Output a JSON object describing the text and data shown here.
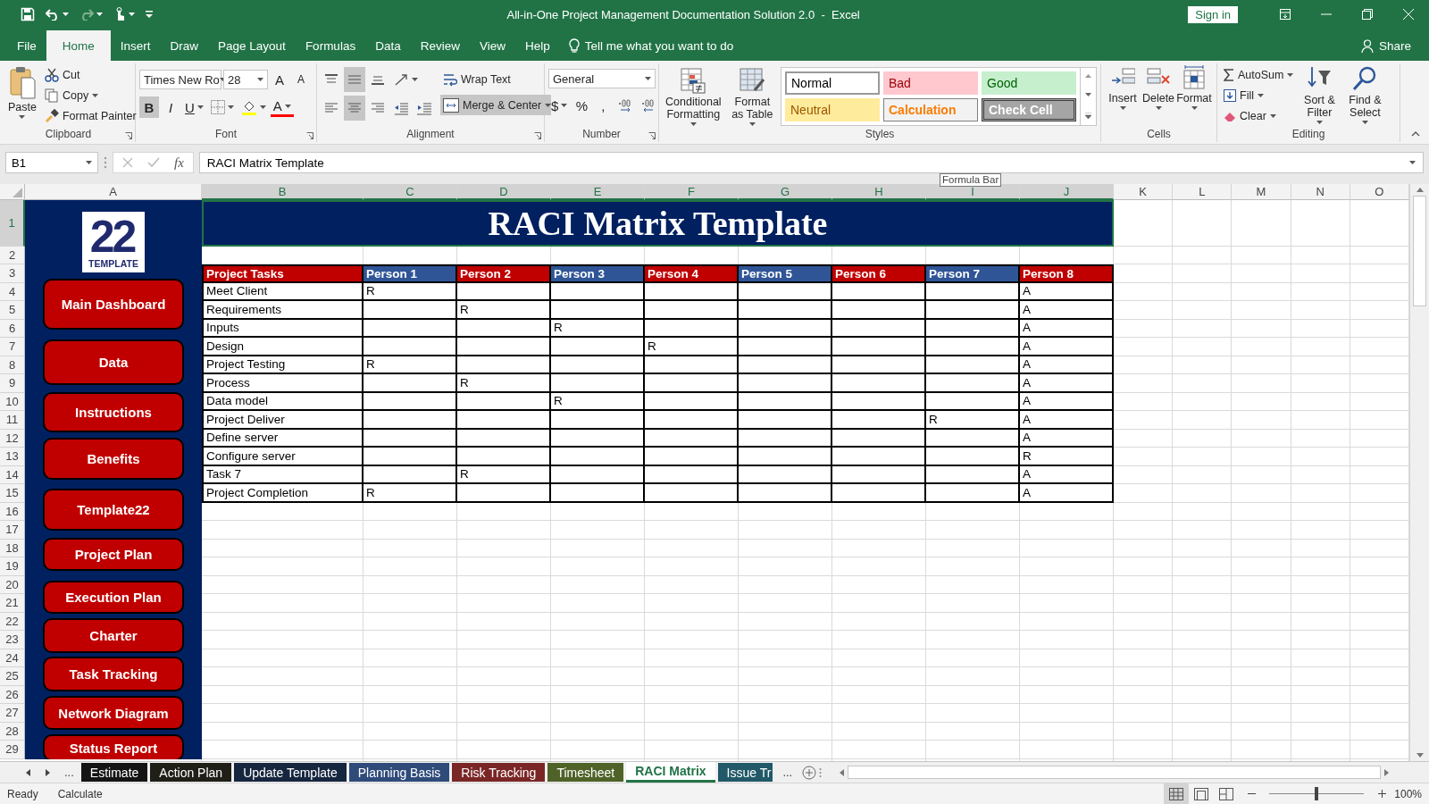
{
  "title_bar": {
    "title": "All-in-One Project Management Documentation Solution 2.0  -  Excel",
    "sign_in": "Sign in"
  },
  "menu_tabs": [
    {
      "label": "File",
      "selected": false
    },
    {
      "label": "Home",
      "selected": true
    },
    {
      "label": "Insert",
      "selected": false
    },
    {
      "label": "Draw",
      "selected": false
    },
    {
      "label": "Page Layout",
      "selected": false
    },
    {
      "label": "Formulas",
      "selected": false
    },
    {
      "label": "Data",
      "selected": false
    },
    {
      "label": "Review",
      "selected": false
    },
    {
      "label": "View",
      "selected": false
    },
    {
      "label": "Help",
      "selected": false
    }
  ],
  "tell_me": "Tell me what you want to do",
  "share": "Share",
  "ribbon": {
    "clipboard": {
      "paste": "Paste",
      "cut": "Cut",
      "copy": "Copy",
      "format_painter": "Format Painter",
      "label": "Clipboard"
    },
    "font": {
      "name": "Times New Ro",
      "size": "28",
      "grow": "A",
      "shrink": "A",
      "styles": [
        {
          "label": "B",
          "pressed": true
        },
        {
          "label": "I",
          "pressed": false
        },
        {
          "label": "U",
          "pressed": false
        }
      ],
      "font_color": "A",
      "label": "Font"
    },
    "alignment": {
      "align_buttons": [
        {
          "pressed": false
        },
        {
          "pressed": true
        },
        {
          "pressed": false
        },
        {
          "pressed": false
        },
        {
          "pressed": true
        },
        {
          "pressed": false
        }
      ],
      "wrap_text": "Wrap Text",
      "merge_center": {
        "label": "Merge & Center",
        "pressed": true
      },
      "label": "Alignment"
    },
    "number": {
      "format": "General",
      "symbols": [
        "$",
        "%",
        ","
      ],
      "label": "Number"
    },
    "styles": {
      "conditional_formatting": "Conditional Formatting",
      "format_as_table": "Format as Table",
      "gallery": [
        {
          "label": "Normal",
          "kind": "normal"
        },
        {
          "label": "Bad",
          "kind": "bad"
        },
        {
          "label": "Good",
          "kind": "good"
        },
        {
          "label": "Neutral",
          "kind": "neutral"
        },
        {
          "label": "Calculation",
          "kind": "calculation"
        },
        {
          "label": "Check Cell",
          "kind": "check"
        }
      ],
      "label": "Styles"
    },
    "cells": {
      "buttons": [
        "Insert",
        "Delete",
        "Format"
      ],
      "label": "Cells"
    },
    "editing": {
      "autosum": "AutoSum",
      "fill": "Fill",
      "clear": "Clear",
      "sort_filter": "Sort & Filter",
      "find_select": "Find & Select",
      "label": "Editing"
    }
  },
  "formula_bar": {
    "name_box": "B1",
    "function_symbol": "fx",
    "formula": "RACI Matrix Template",
    "tooltip": "Formula Bar"
  },
  "sheet": {
    "columns": [
      {
        "label": "A",
        "selected": false
      },
      {
        "label": "B",
        "selected": true
      },
      {
        "label": "C",
        "selected": true
      },
      {
        "label": "D",
        "selected": true
      },
      {
        "label": "E",
        "selected": true
      },
      {
        "label": "F",
        "selected": true
      },
      {
        "label": "G",
        "selected": true
      },
      {
        "label": "H",
        "selected": true
      },
      {
        "label": "I",
        "selected": true
      },
      {
        "label": "J",
        "selected": true
      },
      {
        "label": "K",
        "selected": false
      },
      {
        "label": "L",
        "selected": false
      },
      {
        "label": "M",
        "selected": false
      },
      {
        "label": "N",
        "selected": false
      },
      {
        "label": "O",
        "selected": false
      }
    ],
    "rows": [
      {
        "label": "1",
        "selected": true
      },
      {
        "label": "2",
        "selected": false
      },
      {
        "label": "3",
        "selected": false
      },
      {
        "label": "4",
        "selected": false
      },
      {
        "label": "5",
        "selected": false
      },
      {
        "label": "6",
        "selected": false
      },
      {
        "label": "7",
        "selected": false
      },
      {
        "label": "8",
        "selected": false
      },
      {
        "label": "9",
        "selected": false
      },
      {
        "label": "10",
        "selected": false
      },
      {
        "label": "11",
        "selected": false
      },
      {
        "label": "12",
        "selected": false
      },
      {
        "label": "13",
        "selected": false
      },
      {
        "label": "14",
        "selected": false
      },
      {
        "label": "15",
        "selected": false
      },
      {
        "label": "16",
        "selected": false
      },
      {
        "label": "17",
        "selected": false
      },
      {
        "label": "18",
        "selected": false
      },
      {
        "label": "19",
        "selected": false
      },
      {
        "label": "20",
        "selected": false
      },
      {
        "label": "21",
        "selected": false
      },
      {
        "label": "22",
        "selected": false
      },
      {
        "label": "23",
        "selected": false
      },
      {
        "label": "24",
        "selected": false
      },
      {
        "label": "25",
        "selected": false
      },
      {
        "label": "26",
        "selected": false
      },
      {
        "label": "27",
        "selected": false
      },
      {
        "label": "28",
        "selected": false
      },
      {
        "label": "29",
        "selected": false
      }
    ],
    "logo": {
      "number": "22",
      "word": "TEMPLATE"
    },
    "sidebar_buttons": [
      "Main Dashboard",
      "Data",
      "Instructions",
      "Benefits",
      "Template22",
      "Project Plan",
      "Execution Plan",
      "Charter",
      "Task Tracking",
      "Network Diagram",
      "Status Report"
    ],
    "title": "RACI Matrix Template",
    "table": {
      "headers": [
        {
          "label": "Project Tasks",
          "color": "#c00000"
        },
        {
          "label": "Person 1",
          "color": "#2f5597"
        },
        {
          "label": "Person 2",
          "color": "#c00000"
        },
        {
          "label": "Person 3",
          "color": "#2f5597"
        },
        {
          "label": "Person 4",
          "color": "#c00000"
        },
        {
          "label": "Person 5",
          "color": "#2f5597"
        },
        {
          "label": "Person 6",
          "color": "#c00000"
        },
        {
          "label": "Person 7",
          "color": "#2f5597"
        },
        {
          "label": "Person 8",
          "color": "#c00000"
        }
      ],
      "rows": [
        {
          "task": "Meet Client",
          "entries": {
            "person_1": "R",
            "person_8": "A"
          }
        },
        {
          "task": "Requirements",
          "entries": {
            "person_2": "R",
            "person_8": "A"
          }
        },
        {
          "task": "Inputs",
          "entries": {
            "person_3": "R",
            "person_8": "A"
          }
        },
        {
          "task": "Design",
          "entries": {
            "person_4": "R",
            "person_8": "A"
          }
        },
        {
          "task": "Project Testing",
          "entries": {
            "person_1": "R",
            "person_8": "A"
          }
        },
        {
          "task": "Process",
          "entries": {
            "person_2": "R",
            "person_8": "A"
          }
        },
        {
          "task": "Data model",
          "entries": {
            "person_3": "R",
            "person_8": "A"
          }
        },
        {
          "task": "Project Deliver",
          "entries": {
            "person_7": "R",
            "person_8": "A"
          }
        },
        {
          "task": "Define server",
          "entries": {
            "person_8": "A"
          }
        },
        {
          "task": "Configure server",
          "entries": {
            "person_8": "R"
          }
        },
        {
          "task": "Task 7",
          "entries": {
            "person_2": "R",
            "person_8": "A"
          }
        },
        {
          "task": "Project Completion",
          "entries": {
            "person_1": "R",
            "person_8": "A"
          }
        }
      ]
    }
  },
  "sheet_tabs": {
    "more_left": "...",
    "tabs": [
      {
        "label": "Estimate",
        "color": "#141414",
        "selected": false
      },
      {
        "label": "Action Plan",
        "color": "#1f1f17",
        "selected": false
      },
      {
        "label": "Update Template",
        "color": "#17263f",
        "selected": false
      },
      {
        "label": "Planning Basis",
        "color": "#2f4b7a",
        "selected": false
      },
      {
        "label": "Risk Tracking",
        "color": "#7a2626",
        "selected": false
      },
      {
        "label": "Timesheet",
        "color": "#4f6228",
        "selected": false
      },
      {
        "label": "RACI Matrix",
        "color": "#217346",
        "selected": true
      },
      {
        "label": "Issue Tr",
        "color": "#215968",
        "selected": false
      }
    ],
    "more_right": "..."
  },
  "status_bar": {
    "mode": "Ready",
    "calculate": "Calculate",
    "zoom_slider": {
      "level": 0.5
    },
    "zoom": "100%"
  }
}
